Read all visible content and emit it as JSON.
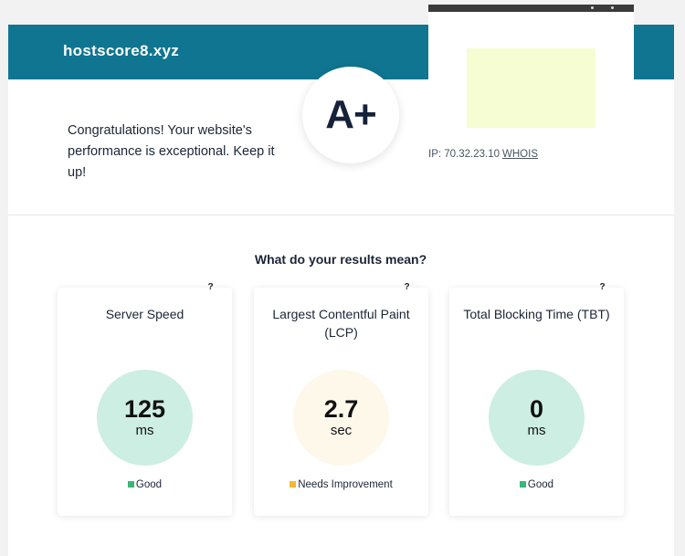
{
  "site": {
    "domain": "hostscore8.xyz"
  },
  "grade": "A+",
  "congrats": "Congratulations! Your website's performance is exceptional. Keep it up!",
  "server": {
    "ip_label": "IP: 70.32.23.10",
    "whois_label": "WHOIS"
  },
  "results": {
    "title": "What do your results mean?",
    "help": "?",
    "metrics": [
      {
        "label": "Server Speed",
        "value": "125",
        "unit": "ms",
        "status": "Good",
        "circle_color": "#cdeee2",
        "status_color": "#3bb57a"
      },
      {
        "label": "Largest Contentful Paint (LCP)",
        "value": "2.7",
        "unit": "sec",
        "status": "Needs Improvement",
        "circle_color": "#fdf8ea",
        "status_color": "#f5b82e"
      },
      {
        "label": "Total Blocking Time (TBT)",
        "value": "0",
        "unit": "ms",
        "status": "Good",
        "circle_color": "#cdeee2",
        "status_color": "#3bb57a"
      }
    ]
  },
  "colors": {
    "banner": "#0f7591",
    "preview_bg": "#f6fdd2"
  }
}
